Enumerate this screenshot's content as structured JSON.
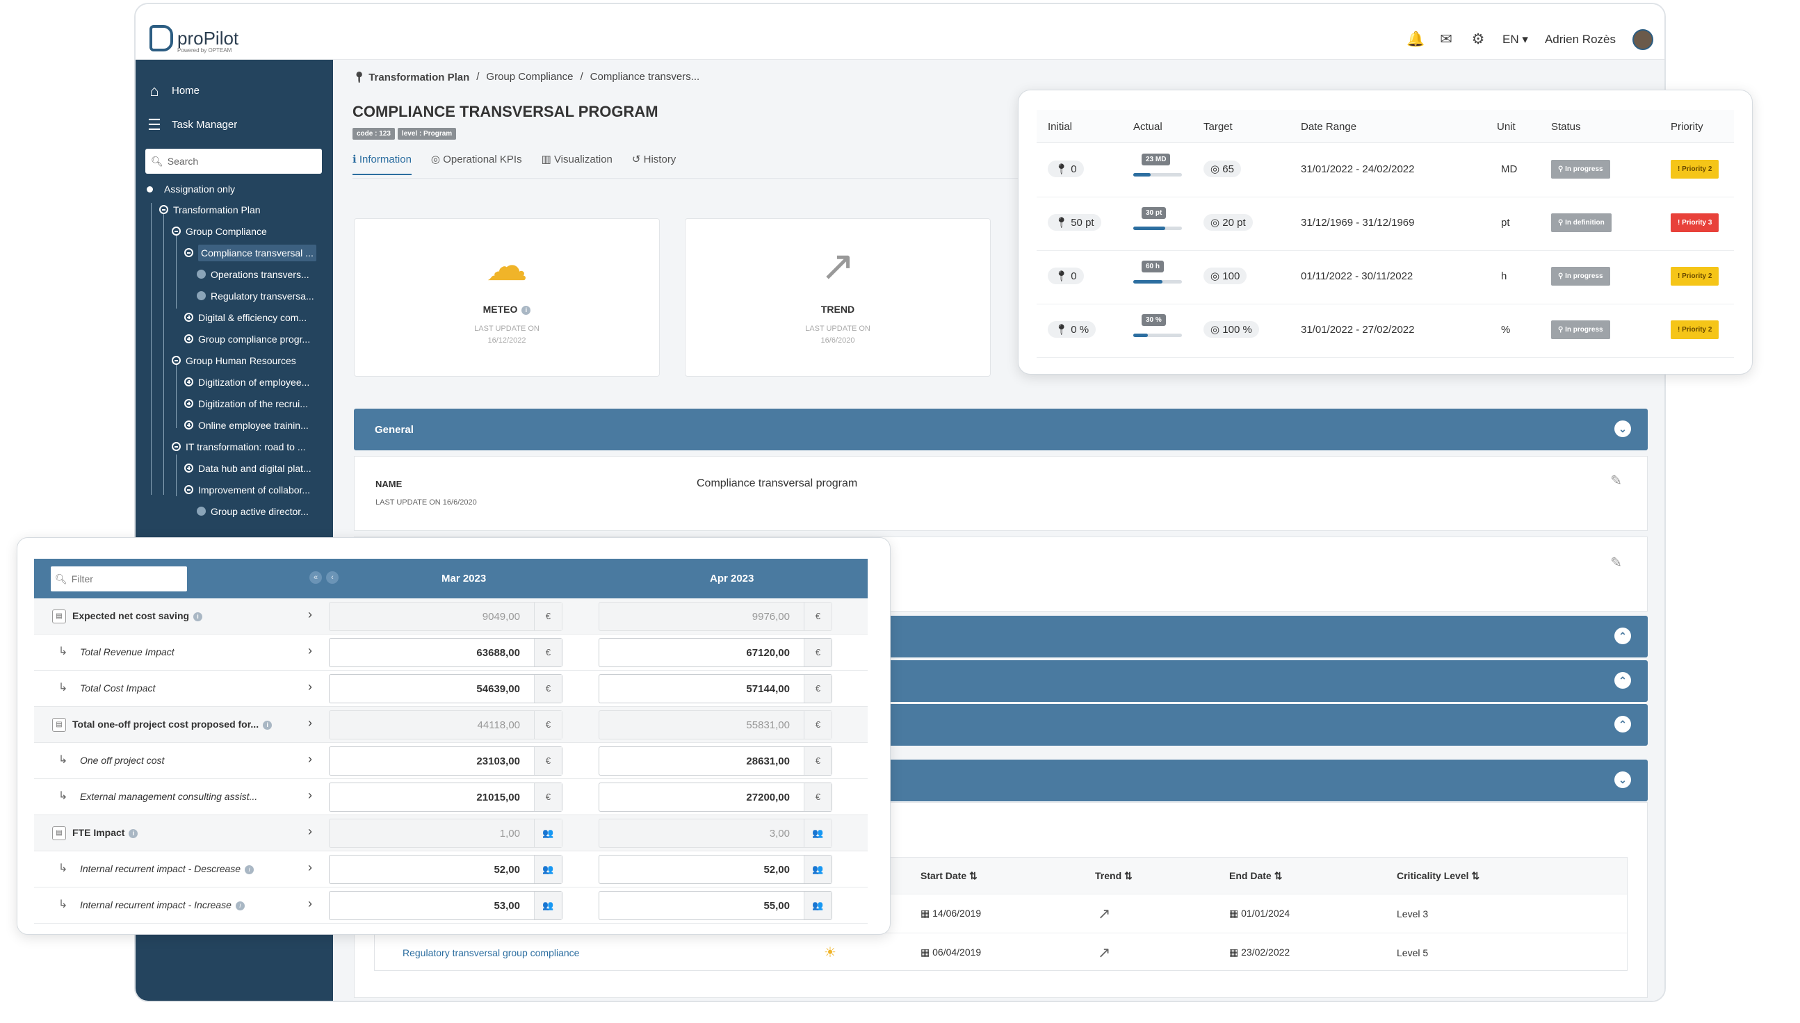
{
  "app": {
    "brand": "proPilot",
    "powered_by": "Powered by OPTEAM"
  },
  "header": {
    "language": "EN",
    "user": "Adrien Rozès"
  },
  "sidebar": {
    "nav": [
      {
        "label": "Home"
      },
      {
        "label": "Task Manager"
      }
    ],
    "search_placeholder": "Search",
    "assignation_only": "Assignation only",
    "tree": [
      {
        "label": "Transformation Plan"
      },
      {
        "label": "Group Compliance"
      },
      {
        "label": "Compliance transversal ..."
      },
      {
        "label": "Operations transvers..."
      },
      {
        "label": "Regulatory transversa..."
      },
      {
        "label": "Digital & efficiency com..."
      },
      {
        "label": "Group compliance progr..."
      },
      {
        "label": "Group Human Resources"
      },
      {
        "label": "Digitization of employee..."
      },
      {
        "label": "Digitization of the recrui..."
      },
      {
        "label": "Online employee trainin..."
      },
      {
        "label": "IT transformation: road to ..."
      },
      {
        "label": "Data hub and digital plat..."
      },
      {
        "label": "Improvement of collabor..."
      },
      {
        "label": "Group active director..."
      }
    ]
  },
  "breadcrumb": [
    "Transformation Plan",
    "/",
    "Group Compliance",
    "/",
    "Compliance transvers..."
  ],
  "page": {
    "title": "COMPLIANCE TRANSVERSAL PROGRAM",
    "badges": [
      "code : 123",
      "level : Program"
    ],
    "tabs": [
      "Information",
      "Operational KPIs",
      "Visualization",
      "History"
    ]
  },
  "cards": [
    {
      "label": "METEO",
      "update_label": "LAST UPDATE ON",
      "date": "16/12/2022",
      "icon": "partly-cloudy-icon"
    },
    {
      "label": "TREND",
      "update_label": "LAST UPDATE ON",
      "date": "16/6/2020",
      "icon": "trend-up-arrow-icon"
    }
  ],
  "general": {
    "section_label": "General",
    "name_label": "NAME",
    "name_update": "LAST UPDATE ON 16/6/2020",
    "name_value": "Compliance transversal program"
  },
  "children_table": {
    "headers": [
      "Start Date",
      "Trend",
      "End Date",
      "Criticality Level"
    ],
    "rows": [
      {
        "name": "",
        "start": "14/06/2019",
        "end": "01/01/2024",
        "level": "Level 3"
      },
      {
        "name": "Regulatory transversal group compliance",
        "start": "06/04/2019",
        "end": "23/02/2022",
        "level": "Level 5"
      }
    ]
  },
  "kpi": {
    "headers": [
      "Initial",
      "Actual",
      "Target",
      "Date Range",
      "Unit",
      "Status",
      "Priority"
    ],
    "rows": [
      {
        "initial": "0",
        "actual_label": "23 MD",
        "actual_fraction": 0.35,
        "target": "65",
        "range": "31/01/2022 - 24/02/2022",
        "unit": "MD",
        "status": "In progress",
        "priority": "Priority 2",
        "priority_color": "#f5c518"
      },
      {
        "initial": "50 pt",
        "actual_label": "30 pt",
        "actual_fraction": 0.66,
        "target": "20 pt",
        "range": "31/12/1969 - 31/12/1969",
        "unit": "pt",
        "status": "In definition",
        "priority": "Priority 3",
        "priority_color": "#e8413a"
      },
      {
        "initial": "0",
        "actual_label": "60 h",
        "actual_fraction": 0.6,
        "target": "100",
        "range": "01/11/2022 - 30/11/2022",
        "unit": "h",
        "status": "In progress",
        "priority": "Priority 2",
        "priority_color": "#f5c518"
      },
      {
        "initial": "0 %",
        "actual_label": "30 %",
        "actual_fraction": 0.3,
        "target": "100 %",
        "range": "31/01/2022 - 27/02/2022",
        "unit": "%",
        "status": "In progress",
        "priority": "Priority 2",
        "priority_color": "#f5c518"
      }
    ]
  },
  "finance": {
    "filter_placeholder": "Filter",
    "months": [
      "Mar 2023",
      "Apr 2023"
    ],
    "rows": [
      {
        "label": "Expected net cost saving",
        "parent": true,
        "info": true,
        "mar": "9049,00",
        "apr": "9976,00",
        "unit": "€"
      },
      {
        "label": "Total Revenue Impact",
        "parent": false,
        "info": false,
        "mar": "63688,00",
        "apr": "67120,00",
        "unit": "€"
      },
      {
        "label": "Total Cost Impact",
        "parent": false,
        "info": false,
        "mar": "54639,00",
        "apr": "57144,00",
        "unit": "€"
      },
      {
        "label": "Total one-off project cost proposed for...",
        "parent": true,
        "info": true,
        "mar": "44118,00",
        "apr": "55831,00",
        "unit": "€"
      },
      {
        "label": "One off project cost",
        "parent": false,
        "info": false,
        "mar": "23103,00",
        "apr": "28631,00",
        "unit": "€"
      },
      {
        "label": "External management consulting assist...",
        "parent": false,
        "info": false,
        "mar": "21015,00",
        "apr": "27200,00",
        "unit": "€"
      },
      {
        "label": "FTE Impact",
        "parent": true,
        "info": true,
        "mar": "1,00",
        "apr": "3,00",
        "unit": "👥"
      },
      {
        "label": "Internal recurrent impact - Descrease",
        "parent": false,
        "info": true,
        "mar": "52,00",
        "apr": "52,00",
        "unit": "👥"
      },
      {
        "label": "Internal recurrent impact - Increase",
        "parent": false,
        "info": true,
        "mar": "53,00",
        "apr": "55,00",
        "unit": "👥"
      }
    ]
  }
}
